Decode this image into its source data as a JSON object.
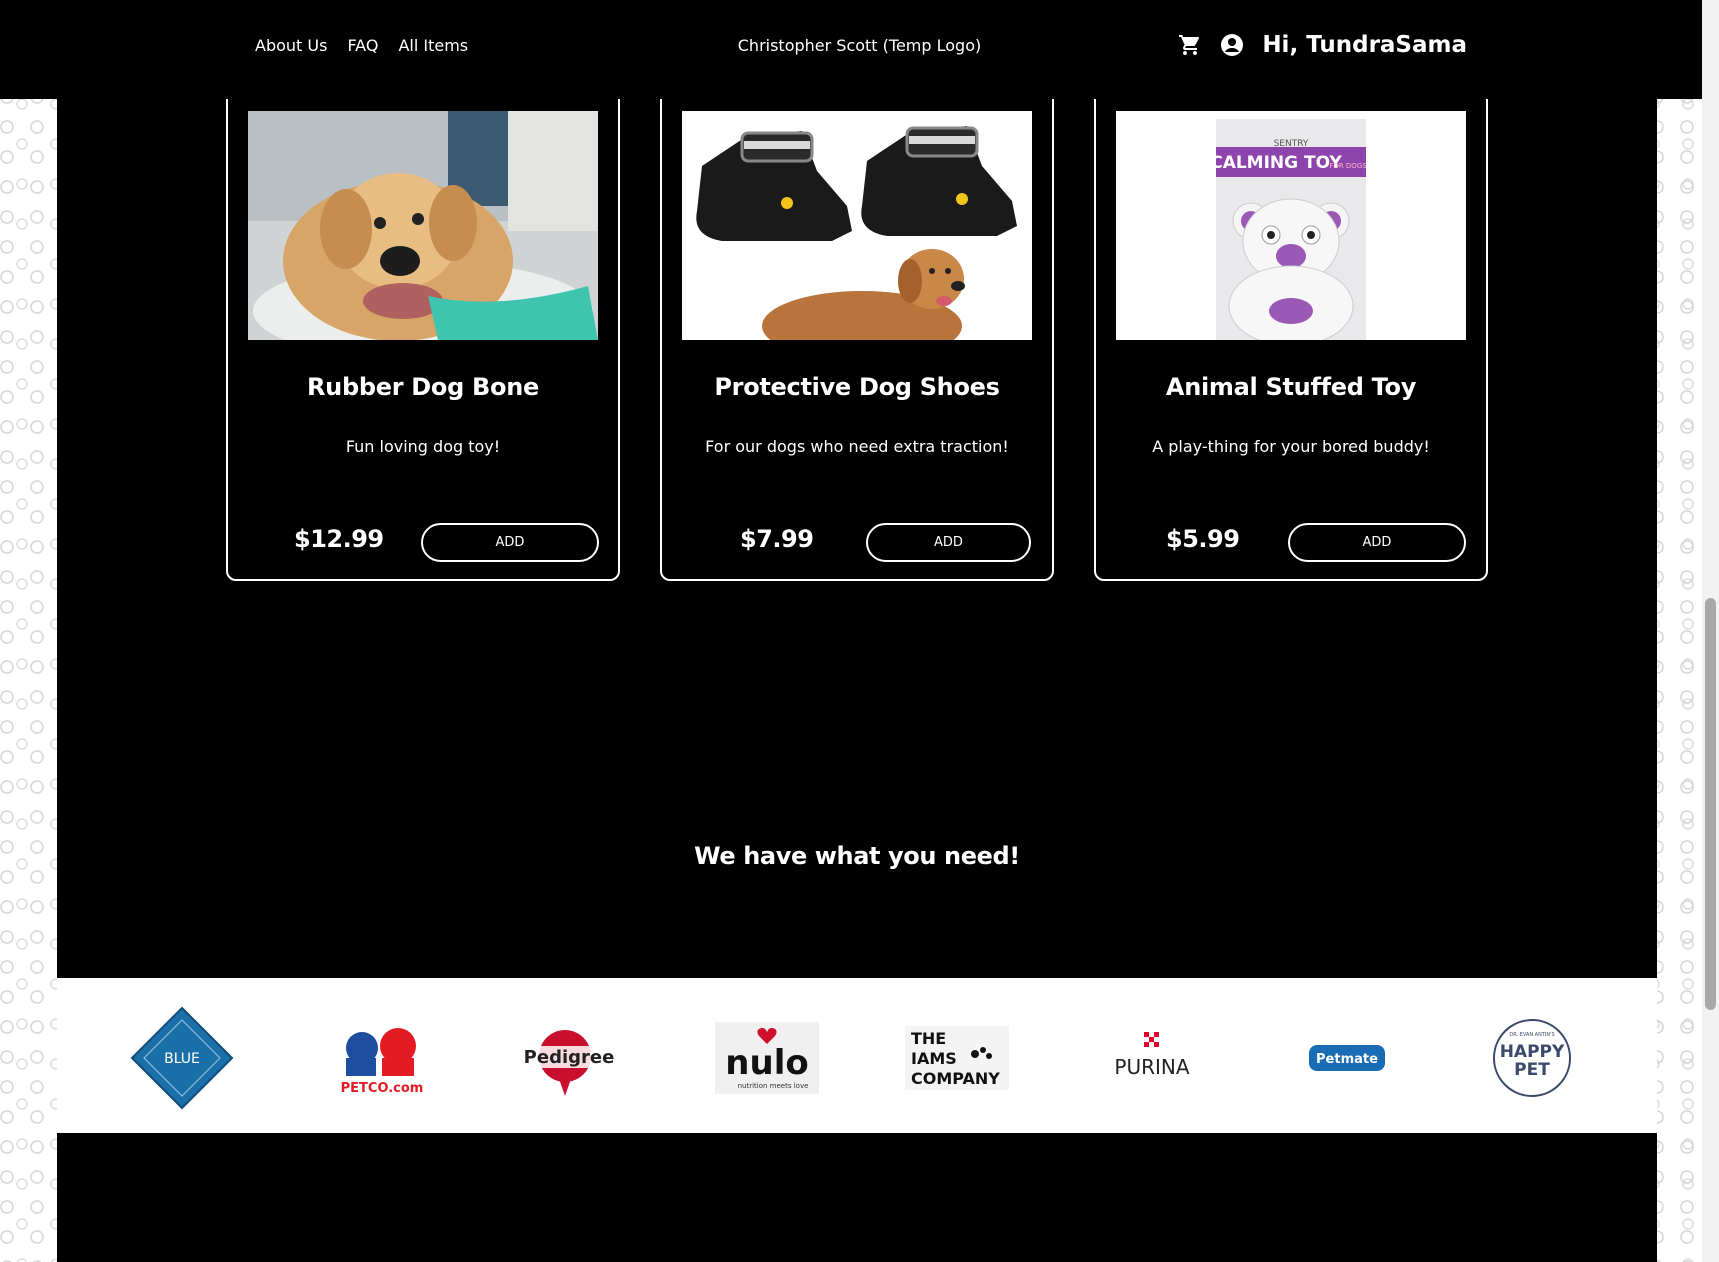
{
  "nav": {
    "links": [
      "About Us",
      "FAQ",
      "All Items"
    ],
    "brand": "Christopher Scott (Temp Logo)",
    "greeting": "Hi, TundraSama"
  },
  "products": [
    {
      "title": "Rubber Dog Bone",
      "description": "Fun loving dog toy!",
      "price": "$12.99",
      "button": "ADD"
    },
    {
      "title": "Protective Dog Shoes",
      "description": "For our dogs who need extra traction!",
      "price": "$7.99",
      "button": "ADD"
    },
    {
      "title": "Animal Stuffed Toy",
      "description": "A play-thing for your bored buddy!",
      "price": "$5.99",
      "button": "ADD"
    }
  ],
  "toy_package": {
    "brand": "SENTRY",
    "label": "CALMING TOY",
    "sub": "FOR DOGS"
  },
  "tagline": "We have what you need!",
  "partners": {
    "blue": "BLUE",
    "petco": "PETCO.com",
    "pedigree": "Pedigree",
    "nulo": "nulo",
    "nulo_sub": "nutrition meets love",
    "iams": [
      "THE",
      "IAMS",
      "COMPANY"
    ],
    "purina": "PURINA",
    "petmate": "Petmate",
    "happypet_top": "DR. EVAN ANTIN'S",
    "happypet": [
      "HAPPY",
      "PET"
    ]
  },
  "colors": {
    "background": "#000000",
    "accent": "#ffffff",
    "petco_red": "#e31b23",
    "petco_blue": "#1f4ea1",
    "blue_buffalo": "#1b6fa8",
    "toy_purple": "#8e44ad"
  }
}
